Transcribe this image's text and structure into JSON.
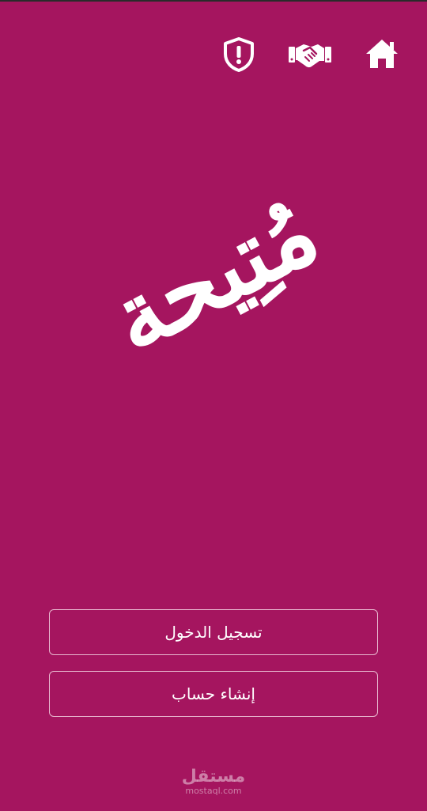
{
  "header": {
    "icons": [
      "shield-alert-icon",
      "handshake-icon",
      "home-icon"
    ]
  },
  "logo": {
    "text": "مُتِيحة"
  },
  "buttons": {
    "login_label": "تسجيل الدخول",
    "register_label": "إنشاء حساب"
  },
  "watermark": {
    "arabic": "مستقل",
    "latin": "mostaql.com"
  },
  "colors": {
    "background": "#a5155f",
    "foreground": "#ffffff",
    "button_border": "#e8b8cf"
  }
}
